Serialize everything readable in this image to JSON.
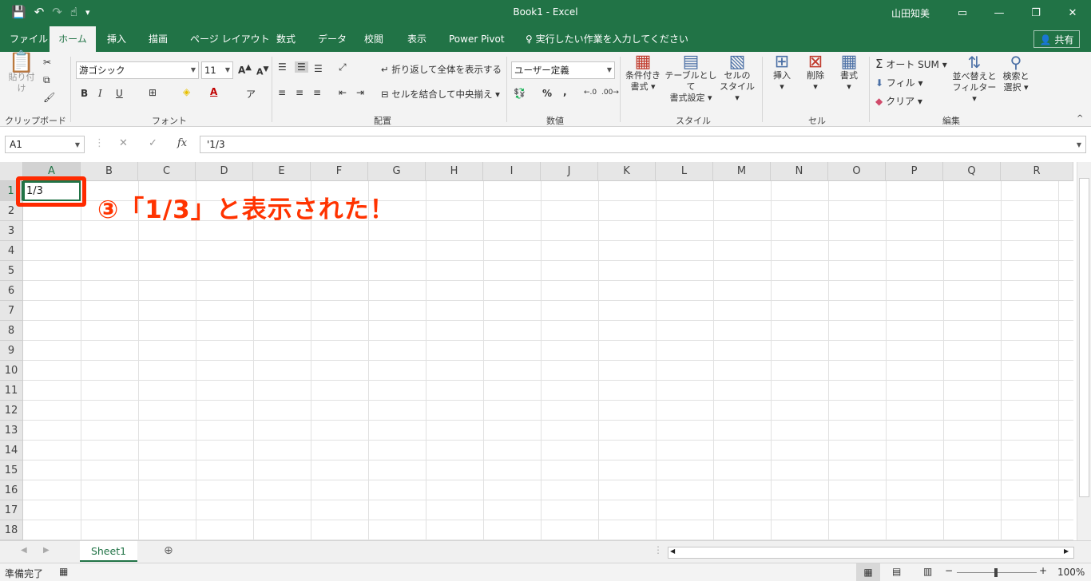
{
  "titlebar": {
    "title": "Book1 - Excel",
    "user": "山田知美",
    "qat_dropdown": "▾"
  },
  "tabs": [
    "ファイル",
    "ホーム",
    "挿入",
    "描画",
    "ページ レイアウト",
    "数式",
    "データ",
    "校閲",
    "表示",
    "Power Pivot"
  ],
  "tell_me": "実行したい作業を入力してください",
  "share": "共有",
  "ribbon": {
    "paste": "貼り付け",
    "clipboard": "クリップボード",
    "font_name": "游ゴシック",
    "font_size": "11",
    "font_group": "フォント",
    "bold": "B",
    "italic": "I",
    "underline": "U",
    "wrap_text": "折り返して全体を表示する",
    "merge": "セルを結合して中央揃え",
    "alignment_group": "配置",
    "number_format": "ユーザー定義",
    "number_group": "数値",
    "percent": "%",
    "comma": ",",
    "cond_format_1": "条件付き",
    "cond_format_2": "書式",
    "table_format_1": "テーブルとして",
    "table_format_2": "書式設定",
    "cell_style_1": "セルの",
    "cell_style_2": "スタイル",
    "style_group": "スタイル",
    "insert": "挿入",
    "delete": "削除",
    "format": "書式",
    "cells_group": "セル",
    "autosum": "オート SUM",
    "fill": "フィル",
    "clear": "クリア",
    "sort_1": "並べ替えと",
    "sort_2": "フィルター",
    "find_1": "検索と",
    "find_2": "選択",
    "editing_group": "編集"
  },
  "formula": {
    "name_box": "A1",
    "content": "'1/3"
  },
  "grid": {
    "columns": [
      "A",
      "B",
      "C",
      "D",
      "E",
      "F",
      "G",
      "H",
      "I",
      "J",
      "K",
      "L",
      "M",
      "N",
      "O",
      "P",
      "Q",
      "R"
    ],
    "rows": [
      "1",
      "2",
      "3",
      "4",
      "5",
      "6",
      "7",
      "8",
      "9",
      "10",
      "11",
      "12",
      "13",
      "14",
      "15",
      "16",
      "17",
      "18"
    ],
    "a1_value": "1/3"
  },
  "annotation": "③「1/3」と表示された！",
  "sheet": {
    "name": "Sheet1"
  },
  "status": {
    "ready": "準備完了",
    "zoom": "100%"
  },
  "colors": {
    "excel_green": "#217346",
    "annotation_red": "#ff3300"
  }
}
